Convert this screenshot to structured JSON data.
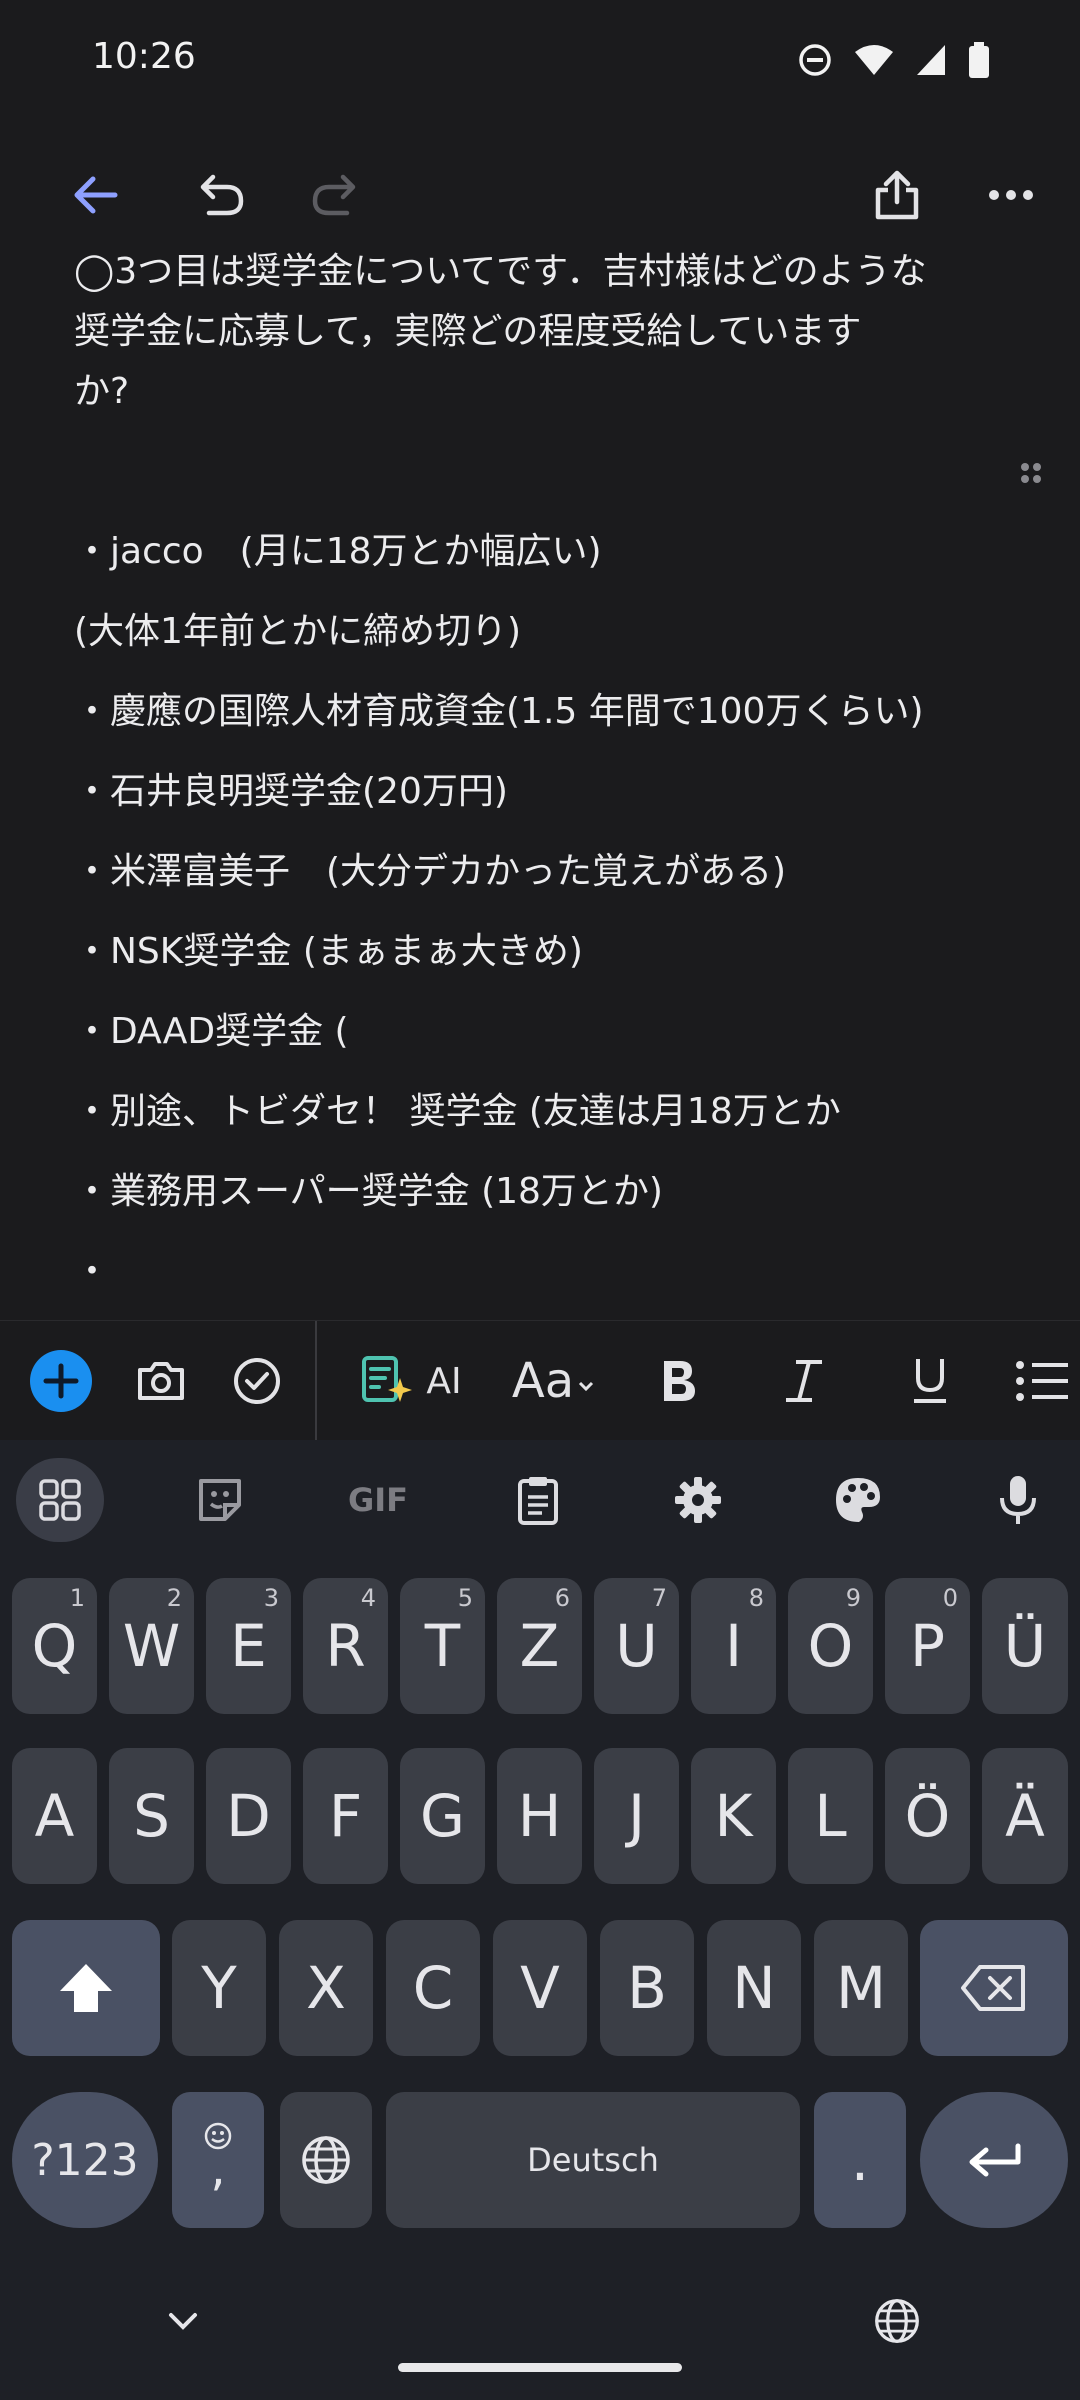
{
  "status_bar": {
    "time": "10:26"
  },
  "toolbar": {
    "icons": [
      "back-arrow-icon",
      "undo-icon",
      "redo-icon",
      "share-icon",
      "more-icon"
    ],
    "accent": "#8ea0ff"
  },
  "document": {
    "lines": [
      "◯3つ目は奨学金についてです．吉村様はどのような",
      "奨学金に応募して，実際どの程度受給しています",
      "か?",
      "・jacco　(月に18万とか幅広い)",
      "(大体1年前とかに締め切り)",
      "・慶應の国際人材育成資金(1.5 年間で100万くらい)",
      "・石井良明奨学金(20万円)",
      "・米澤富美子　(大分デカかった覚えがある)",
      "・NSK奨学金 (まぁまぁ大きめ)",
      "・DAAD奨学金 (",
      "・別途、トビダセ！ 奨学金 (友達は月18万とか",
      "・業務用スーパー奨学金 (18万とか)",
      "・"
    ]
  },
  "format_bar": {
    "ai_label": "AI",
    "text_style_label": "Aa",
    "add_color": "#1a8ff0"
  },
  "keyboard": {
    "tool_icons": [
      "apps-grid-icon",
      "sticker-icon",
      "gif-icon",
      "clipboard-icon",
      "settings-icon",
      "palette-icon",
      "mic-icon"
    ],
    "gif_label": "GIF",
    "row1": [
      {
        "label": "Q",
        "hint": "1"
      },
      {
        "label": "W",
        "hint": "2"
      },
      {
        "label": "E",
        "hint": "3"
      },
      {
        "label": "R",
        "hint": "4"
      },
      {
        "label": "T",
        "hint": "5"
      },
      {
        "label": "Z",
        "hint": "6"
      },
      {
        "label": "U",
        "hint": "7"
      },
      {
        "label": "I",
        "hint": "8"
      },
      {
        "label": "O",
        "hint": "9"
      },
      {
        "label": "P",
        "hint": "0"
      },
      {
        "label": "Ü",
        "hint": ""
      }
    ],
    "row2": [
      "A",
      "S",
      "D",
      "F",
      "G",
      "H",
      "J",
      "K",
      "L",
      "Ö",
      "Ä"
    ],
    "row3": [
      "Y",
      "X",
      "C",
      "V",
      "B",
      "N",
      "M"
    ],
    "symbols_label": "?123",
    "comma_label": ",",
    "space_label": "Deutsch",
    "period_label": "."
  }
}
